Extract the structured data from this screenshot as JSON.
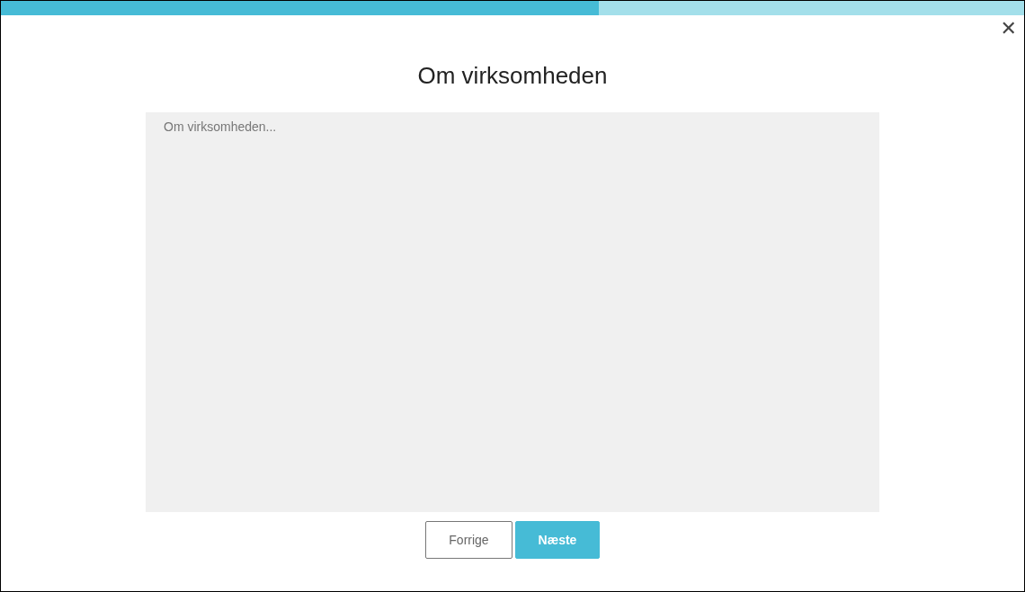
{
  "progress": {
    "level": 0.584
  },
  "close": {
    "label": "✕"
  },
  "title": "Om virksomheden",
  "textarea": {
    "placeholder": "Om virksomheden..."
  },
  "buttons": [
    {
      "label": "Forrige",
      "kind": "secondary"
    },
    {
      "label": "Næste",
      "kind": "primary"
    }
  ]
}
